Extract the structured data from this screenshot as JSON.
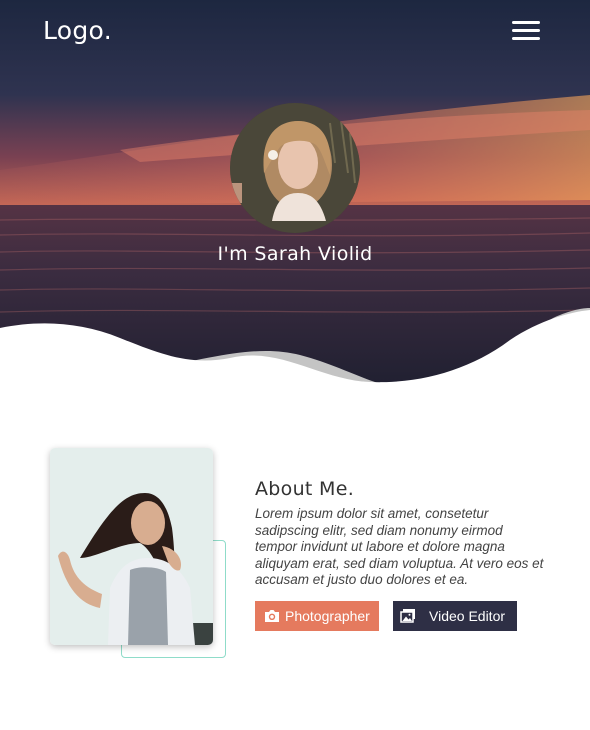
{
  "header": {
    "logo": "Logo.",
    "menu_icon": "hamburger-menu-icon"
  },
  "hero": {
    "name": "I'm Sarah Violid",
    "background": "sunset-sea-photo",
    "avatar": "profile-photo-woman"
  },
  "about": {
    "title": "About Me.",
    "body": "Lorem ipsum dolor sit amet, consetetur sadipscing elitr, sed diam nonumy eirmod tempor invidunt ut labore et dolore magna aliquyam erat, sed diam voluptua. At vero eos et accusam et justo duo dolores et ea.",
    "photo": "portrait-photo-woman"
  },
  "buttons": [
    {
      "label": "Photographer",
      "icon": "camera-icon",
      "color": "#e57a5e"
    },
    {
      "label": "Video Editor",
      "icon": "gallery-icon",
      "color": "#2e2f45"
    }
  ],
  "colors": {
    "accent_orange": "#e57a5e",
    "accent_navy": "#2e2f45",
    "frame_teal": "#8fdcc9"
  }
}
